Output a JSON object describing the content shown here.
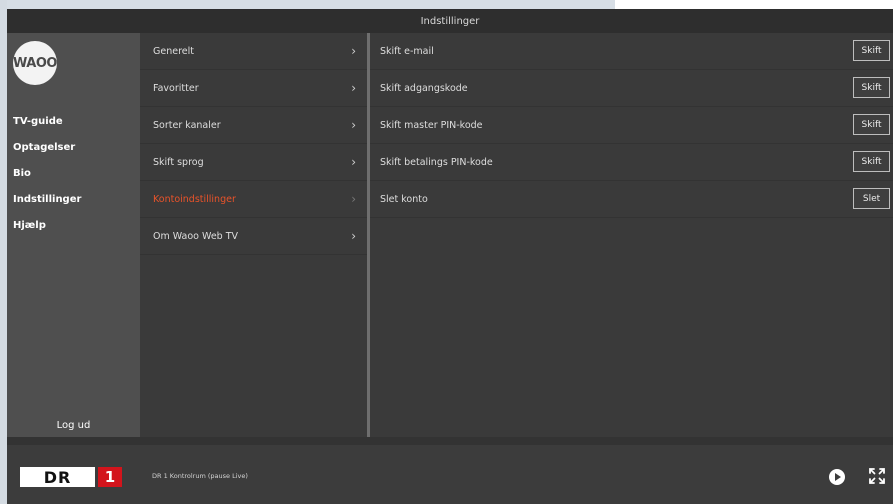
{
  "window": {
    "title": "Indstillinger"
  },
  "logo": {
    "text": "WAOO"
  },
  "sidebar": {
    "items": [
      {
        "label": "TV-guide"
      },
      {
        "label": "Optagelser"
      },
      {
        "label": "Bio"
      },
      {
        "label": "Indstillinger"
      },
      {
        "label": "Hjælp"
      }
    ],
    "logout": "Log ud"
  },
  "settings_menu": {
    "items": [
      {
        "label": "Generelt",
        "active": false
      },
      {
        "label": "Favoritter",
        "active": false
      },
      {
        "label": "Sorter kanaler",
        "active": false
      },
      {
        "label": "Skift sprog",
        "active": false
      },
      {
        "label": "Kontoindstillinger",
        "active": true
      },
      {
        "label": "Om Waoo Web TV",
        "active": false
      }
    ],
    "active_color": "#e8532a"
  },
  "account_settings": {
    "rows": [
      {
        "label": "Skift e-mail",
        "button": "Skift"
      },
      {
        "label": "Skift adgangskode",
        "button": "Skift"
      },
      {
        "label": "Skift master PIN-kode",
        "button": "Skift"
      },
      {
        "label": "Skift betalings PIN-kode",
        "button": "Skift"
      },
      {
        "label": "Slet konto",
        "button": "Slet"
      }
    ]
  },
  "player": {
    "channel_name": "DR",
    "channel_number": "1",
    "now_playing": "DR 1 Kontrolrum (pause Live)",
    "icons": [
      "play-icon",
      "fullscreen-icon"
    ],
    "channel_color": "#d3141c"
  }
}
